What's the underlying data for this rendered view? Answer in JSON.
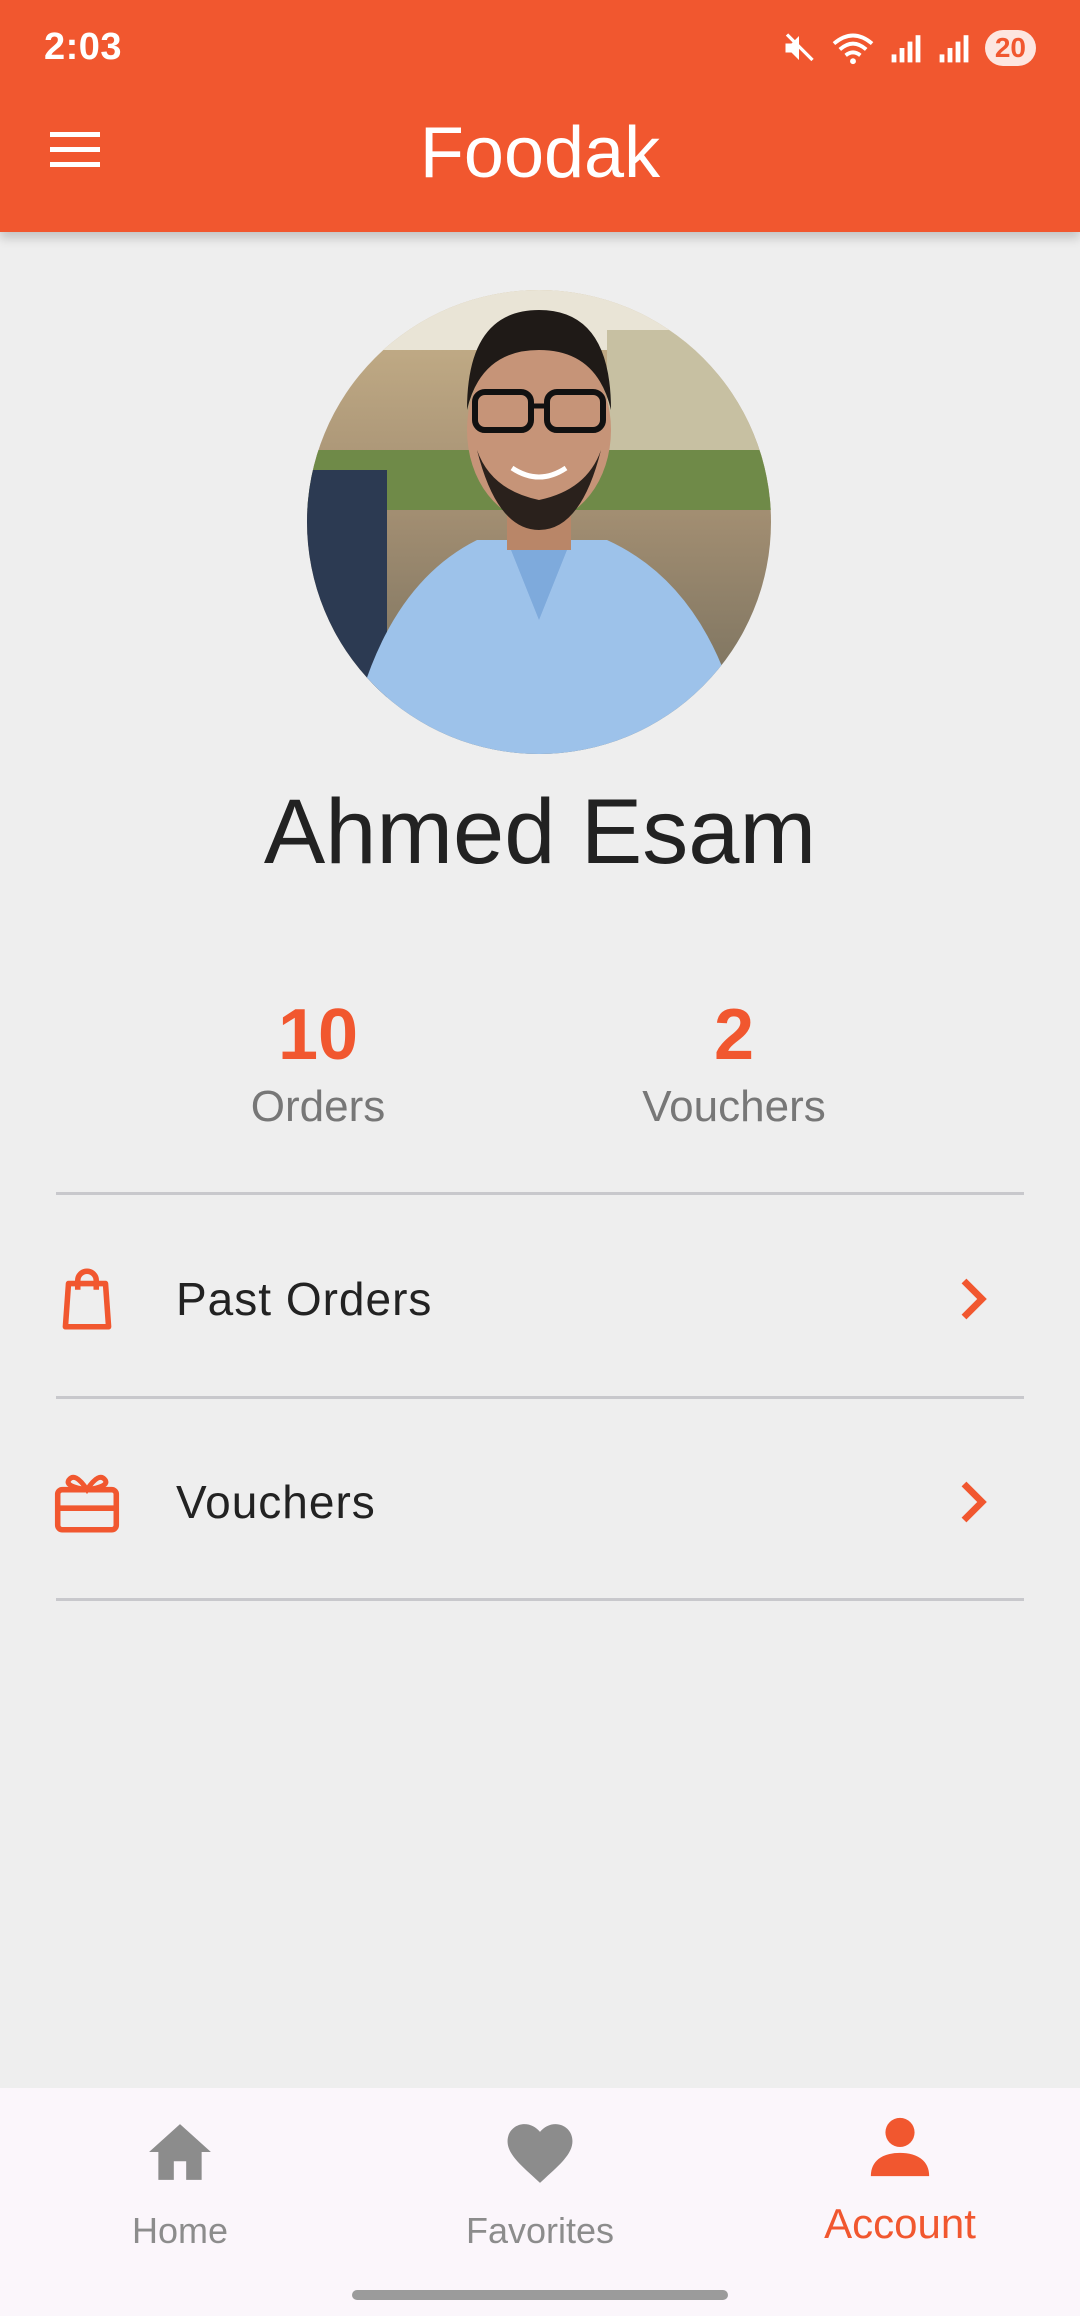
{
  "status_bar": {
    "time": "2:03",
    "battery": "20"
  },
  "header": {
    "title": "Foodak",
    "menu_icon": "hamburger-menu-icon"
  },
  "profile": {
    "name": "Ahmed Esam",
    "avatar_alt": "Ahmed Esam"
  },
  "stats": [
    {
      "value": "10",
      "label": "Orders"
    },
    {
      "value": "2",
      "label": "Vouchers"
    }
  ],
  "menu": [
    {
      "label": "Past Orders",
      "icon": "shopping-bag-icon"
    },
    {
      "label": "Vouchers",
      "icon": "gift-icon"
    }
  ],
  "bottom_nav": [
    {
      "label": "Home",
      "icon": "home-icon",
      "active": false
    },
    {
      "label": "Favorites",
      "icon": "heart-icon",
      "active": false
    },
    {
      "label": "Account",
      "icon": "person-icon",
      "active": true
    }
  ],
  "colors": {
    "accent": "#f1572f",
    "background": "#eeeeee",
    "nav_background": "#fbf6fb",
    "inactive": "#8c8c8c"
  }
}
